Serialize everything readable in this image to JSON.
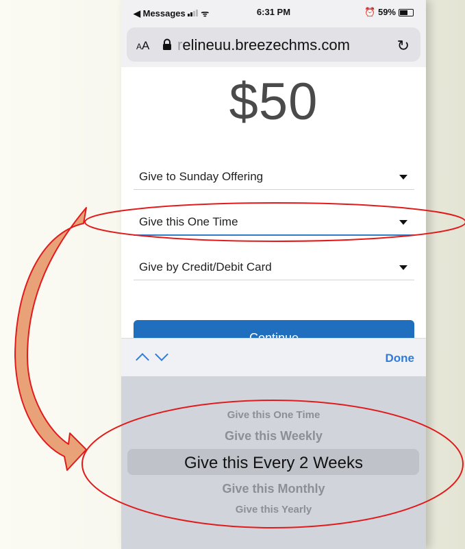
{
  "status": {
    "left": "◀ Messages",
    "time": "6:31 PM",
    "battery": "59%"
  },
  "url_bar": {
    "aa_small": "A",
    "aa_large": "A",
    "url_faded": "r",
    "url": "elineuu.breezechms.com",
    "reload_icon": "↻"
  },
  "amount": "$50",
  "selects": [
    {
      "label": "Give to Sunday Offering"
    },
    {
      "label": "Give this One Time"
    },
    {
      "label": "Give by Credit/Debit Card"
    }
  ],
  "continue_label": "Continue",
  "toolbar": {
    "done_label": "Done"
  },
  "picker": {
    "options": [
      "Give this One Time",
      "Give this Weekly",
      "Give this Every 2 Weeks",
      "Give this Monthly",
      "Give this Yearly"
    ],
    "selected_index": 2
  },
  "colors": {
    "accent": "#2f7bd6",
    "button": "#1f6fbe",
    "annotation": "#e11b1b",
    "arrow_fill": "#e9a178"
  }
}
